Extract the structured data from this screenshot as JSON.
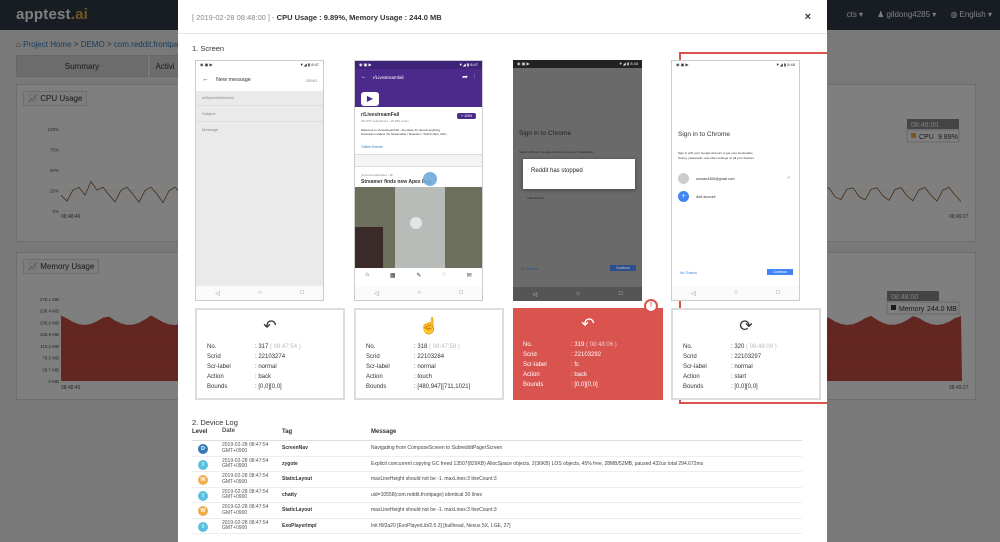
{
  "app": {
    "brand_main": "apptest",
    "brand_suffix": ".ai",
    "nav_projects": "cts ▾",
    "nav_user": "♟ gildong4285 ▾",
    "nav_lang": "◍ English ▾"
  },
  "breadcrumb": {
    "home": "Project Home",
    "sep": ">",
    "demo": "DEMO",
    "app": "com.reddit.frontpag"
  },
  "bg_tabs": [
    "Summary",
    "Activi"
  ],
  "cpu_panel": {
    "title": "CPU Usage",
    "y_ticks": [
      "100%",
      "75%",
      "50%",
      "25%",
      "0%"
    ],
    "x_start": "08:48:46",
    "x_end": "08:49:27",
    "tooltip_time": "08:48:00",
    "tooltip_label": "CPU",
    "tooltip_value": "9.89%"
  },
  "mem_panel": {
    "title": "Memory Usage",
    "y_ticks": [
      "278.1 MB",
      "238.4 MB",
      "198.6 MB",
      "158.9 MB",
      "119.2 MB",
      "79.5 MB",
      "39.7 MB",
      "0 MB"
    ],
    "x_start": "08:48:46",
    "x_end": "08:49:27",
    "tooltip_time": "08:48:00",
    "tooltip_label": "Memory",
    "tooltip_value": "244.0 MB"
  },
  "modal": {
    "title_time": "[ 2019-02-28 08:48:00 ] - ",
    "title_metrics": "CPU Usage : 9.89%, Memory Usage : 244.0 MB",
    "close": "×",
    "section_screen": "1. Screen",
    "section_log": "2. Device Log"
  },
  "screens": [
    {
      "toolbar_title": "New message",
      "toolbar_action": "SEND",
      "lines": [
        "u/Hyeon###lololol",
        "Subject",
        "Message"
      ]
    },
    {
      "sub_name": "r/LivestreamFail",
      "stats": "301,877 subscribers • 25,869 online",
      "join": "+ JOIN",
      "desc1": "Welcome to r/LivestreamFail - the place for almost anything",
      "desc2": "livestream related. No Streamable / Reaction / Twitch clips, GIFs",
      "wiki": "Online Events",
      "post_meta": "u/HyeonsHelloHere • 8h",
      "post_title": "Streamer finds new Apex bug"
    },
    {
      "title": "Sign in to Chrome",
      "sub": "Signin with your Google Account to get your bookmarks,",
      "dialog": "Reddit has stopped",
      "account": "Add account",
      "no_thanks": "No Thanks",
      "continue": "Continue"
    },
    {
      "title": "Sign in to Chrome",
      "sub1": "Sign in with your Google Account to get your bookmarks,",
      "sub2": "history, passwords, and other settings on all your devices",
      "email": "woman4365@gmail.com",
      "add": "Add account",
      "no_thanks": "No Thanks",
      "continue": "Continue"
    }
  ],
  "steps": [
    {
      "icon": "↶",
      "no": "317",
      "no_time": "( 08:47:54 )",
      "scrid": "22103274",
      "scrlabel": "normal",
      "action": "back",
      "bounds": "[0,0][0,0]"
    },
    {
      "icon": "☝",
      "no": "318",
      "no_time": "( 08:47:59 )",
      "scrid": "22103284",
      "scrlabel": "normal",
      "action": "touch",
      "bounds": "[480,947][711,1021]"
    },
    {
      "icon": "↶",
      "no": "319",
      "no_time": "( 08:48:06 )",
      "scrid": "22103292",
      "scrlabel": "fc",
      "action": "back",
      "bounds": "[0,0][0,0]"
    },
    {
      "icon": "⟳",
      "no": "320",
      "no_time": "( 08:48:09 )",
      "scrid": "22103297",
      "scrlabel": "normal",
      "action": "start",
      "bounds": "[0,0][0,0]"
    }
  ],
  "step_labels": {
    "no": "No.",
    "scrid": "Scrid",
    "scrlabel": "Scr-label",
    "action": "Action",
    "bounds": "Bounds",
    "colon": ":"
  },
  "selected_badge": "!",
  "log": {
    "headers": [
      "Level",
      "Date",
      "Tag",
      "Message"
    ],
    "rows": [
      {
        "level": "D",
        "color": "#337ab7",
        "date1": "2019-02-28 08:47:54",
        "date2": "GMT+0900",
        "tag": "ScreenNav",
        "msg": "Navigating from ComposeScreen to SubredditPagerScreen"
      },
      {
        "level": "I",
        "color": "#5bc0de",
        "date1": "2019-02-28 08:47:54",
        "date2": "GMT+0900",
        "tag": "zygote",
        "msg": "Explicit concurrent copying GC freed 13507(829KB) AllocSpace objects, 2(36KB) LOS objects, 45% free, 28MB/52MB, paused 432us total 294.672ms"
      },
      {
        "level": "W",
        "color": "#f0ad4e",
        "date1": "2019-02-28 08:47:54",
        "date2": "GMT+0900",
        "tag": "StaticLayout",
        "msg": "maxLineHeight should not be -1.  maxLines:3 lineCount:3"
      },
      {
        "level": "I",
        "color": "#5bc0de",
        "date1": "2019-02-28 08:47:54",
        "date2": "GMT+0900",
        "tag": "chatty",
        "msg": "uid=10558(com.reddit.frontpage) identical 30 lines"
      },
      {
        "level": "W",
        "color": "#f0ad4e",
        "date1": "2019-02-28 08:47:54",
        "date2": "GMT+0900",
        "tag": "StaticLayout",
        "msg": "maxLineHeight should not be -1.  maxLines:3 lineCount:3"
      },
      {
        "level": "I",
        "color": "#5bc0de",
        "date1": "2019-02-28 08:47:54",
        "date2": "GMT+0900",
        "tag": "ExoPlayerImpl",
        "msg": "Init f6f2a20 [ExoPlayerLib/2.5.3] [bullhead, Nexus 5X, LGE, 27]"
      }
    ]
  },
  "colors": {
    "topbar": "#2f3a44",
    "accent": "#d9534f",
    "link": "#337ab7",
    "reddit_purple": "#4b2a8c"
  }
}
